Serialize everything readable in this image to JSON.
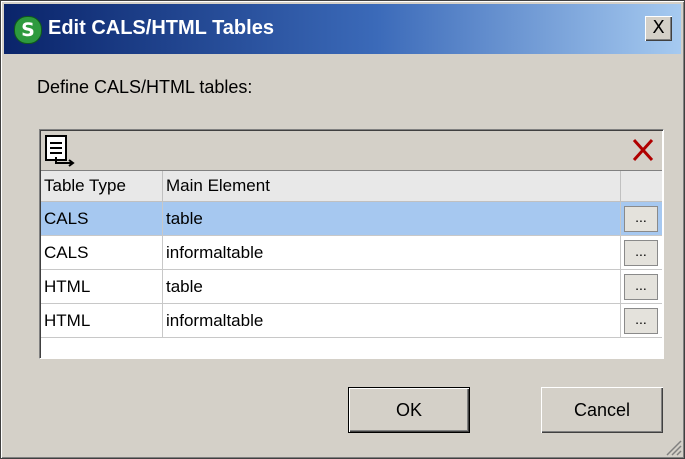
{
  "window": {
    "title": "Edit CALS/HTML Tables",
    "close_label": "X"
  },
  "prompt": "Define CALS/HTML tables:",
  "grid": {
    "columns": [
      "Table Type",
      "Main Element"
    ],
    "rows": [
      {
        "type": "CALS",
        "element": "table",
        "selected": true
      },
      {
        "type": "CALS",
        "element": "informaltable",
        "selected": false
      },
      {
        "type": "HTML",
        "element": "table",
        "selected": false
      },
      {
        "type": "HTML",
        "element": "informaltable",
        "selected": false
      }
    ],
    "row_button_label": "...",
    "toolbar_icons": [
      "append-row-icon",
      "delete-row-icon"
    ]
  },
  "buttons": {
    "ok": "OK",
    "cancel": "Cancel"
  },
  "colors": {
    "selection": "#a6c8f0",
    "title_start": "#0a246a",
    "title_end": "#a6caf0",
    "delete_icon": "#b00000"
  }
}
